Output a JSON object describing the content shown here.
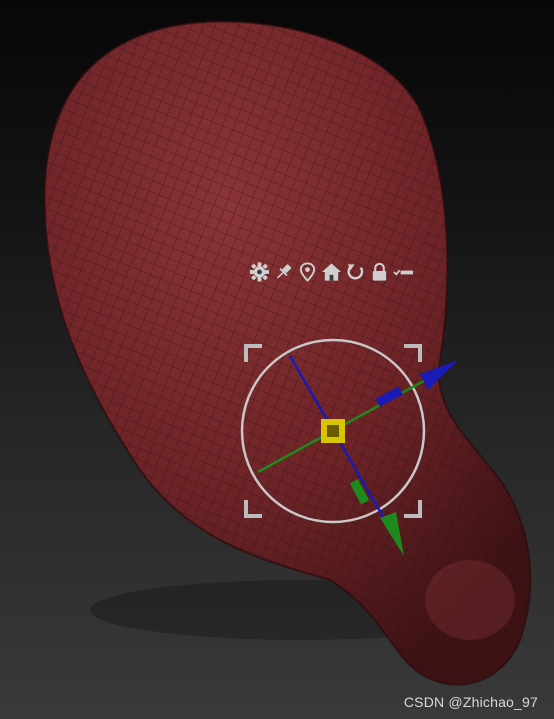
{
  "viewport": {
    "background_top": "#070707",
    "background_bottom": "#3a3a3a"
  },
  "mesh": {
    "color": "#7a2a2c",
    "wire_color": "#2b1012"
  },
  "gizmo": {
    "toolbar": [
      {
        "icon": "gear-icon"
      },
      {
        "icon": "pin-icon"
      },
      {
        "icon": "location-pin-icon"
      },
      {
        "icon": "home-icon"
      },
      {
        "icon": "reset-rotate-icon"
      },
      {
        "icon": "lock-icon"
      },
      {
        "icon": "mask-toggle-icon"
      }
    ],
    "axis_colors": {
      "x": "#1a1ab4",
      "y": "#1c8a1c",
      "center": "#d8c400",
      "ring": "#c8c8c8"
    }
  },
  "watermark": "CSDN @Zhichao_97"
}
